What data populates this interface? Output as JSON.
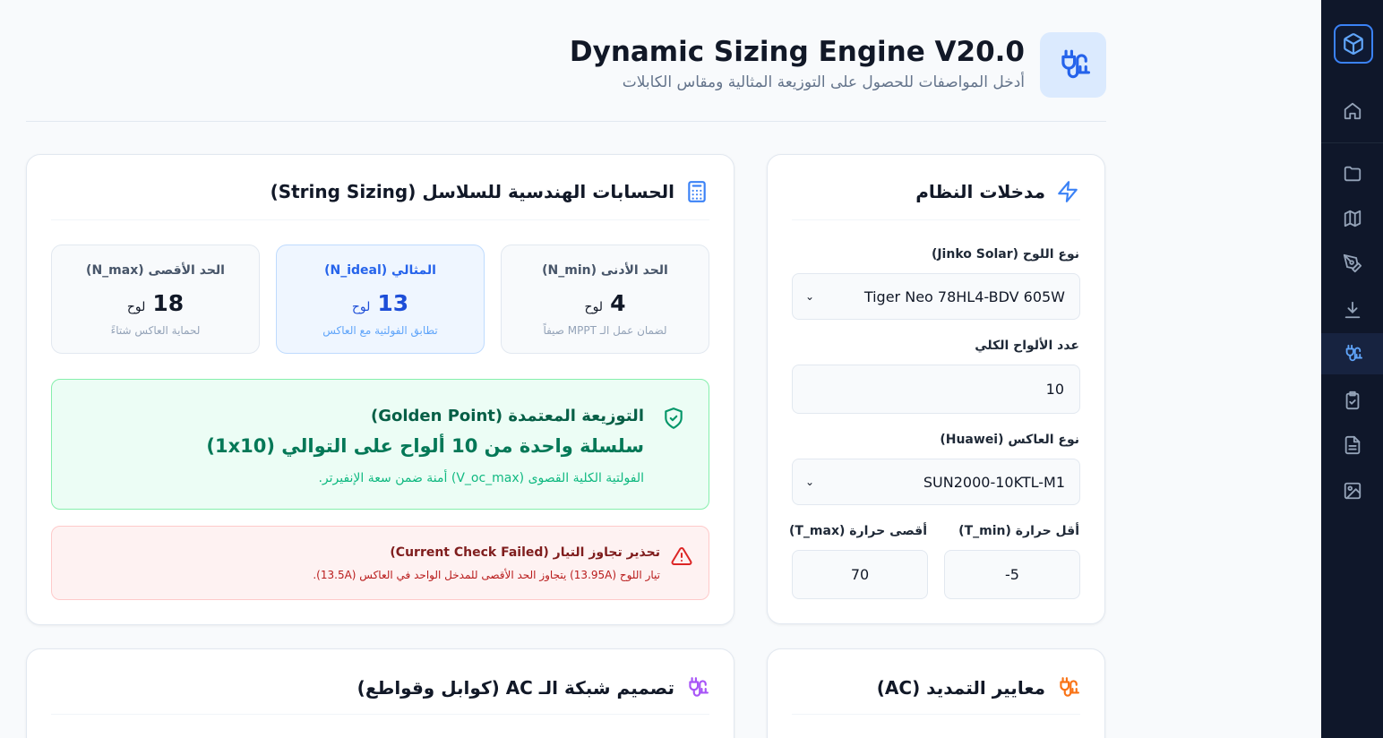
{
  "header": {
    "title": "Dynamic Sizing Engine V20.0",
    "subtitle": "أدخل المواصفات للحصول على التوزيعة المثالية ومقاس الكابلات",
    "icon": "plug-icon"
  },
  "sidebar": {
    "logo_icon": "cube-icon",
    "items": [
      {
        "icon": "home-icon",
        "active": false
      },
      {
        "icon": "folder-icon",
        "active": false
      },
      {
        "icon": "map-icon",
        "active": false
      },
      {
        "icon": "pen-tool-icon",
        "active": false
      },
      {
        "icon": "download-icon",
        "active": false
      },
      {
        "icon": "plug-icon",
        "active": true
      },
      {
        "icon": "clipboard-check-icon",
        "active": false
      },
      {
        "icon": "document-icon",
        "active": false
      },
      {
        "icon": "image-icon",
        "active": false
      }
    ]
  },
  "inputs": {
    "title": "مدخلات النظام",
    "panel_label": "نوع اللوح (Jinko Solar)",
    "panel_value": "Tiger Neo 78HL4-BDV 605W",
    "count_label": "عدد الألواح الكلي",
    "count_value": "10",
    "inverter_label": "نوع العاكس (Huawei)",
    "inverter_value": "SUN2000-10KTL-M1",
    "tmin_label": "أقل حرارة (T_min)",
    "tmin_value": "-5",
    "tmax_label": "أقصى حرارة (T_max)",
    "tmax_value": "70"
  },
  "sizing": {
    "title": "الحسابات الهندسية للسلاسل (String Sizing)",
    "unit": "لوح",
    "min": {
      "label": "الحد الأدنى (N_min)",
      "value": "4",
      "note": "لضمان عمل الـ MPPT صيفاً"
    },
    "ideal": {
      "label": "المثالي (N_ideal)",
      "value": "13",
      "note": "تطابق الفولتية مع العاكس"
    },
    "max": {
      "label": "الحد الأقصى (N_max)",
      "value": "18",
      "note": "لحماية العاكس شتاءً"
    },
    "golden": {
      "title": "التوزيعة المعتمدة (Golden Point)",
      "main": "سلسلة واحدة من 10 ألواح على التوالي (1x10)",
      "note": "الفولتية الكلية القصوى (V_oc_max) أمنة ضمن سعة الإنفيرتر."
    },
    "warning": {
      "title": "تحذير تجاوز التيار (Current Check Failed)",
      "note": "تيار اللوح (13.95A) يتجاوز الحد الأقصى للمدخل الواحد في العاكس (13.5A)."
    }
  },
  "ac_criteria": {
    "title": "معايير التمديد (AC)"
  },
  "ac_network": {
    "title": "تصميم شبكة الـ AC (كوابل وقواطع)"
  },
  "colors": {
    "accent": "#3b82f6",
    "sidebar_bg": "#0f172a",
    "success": "#047857",
    "danger": "#dc2626",
    "orange": "#f97316",
    "purple": "#a855f7"
  }
}
